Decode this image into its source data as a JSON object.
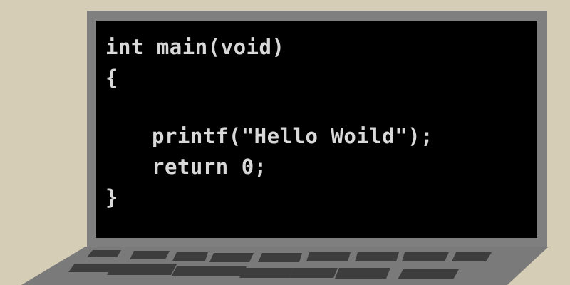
{
  "code": {
    "line1": "int main(void)",
    "line2": "{",
    "line3": "printf(\"Hello Woild\");",
    "line4": "return 0;",
    "line5": "}"
  },
  "colors": {
    "background": "#d5cdb6",
    "bezel": "#7f7f7f",
    "screen": "#000000",
    "code_text": "#d9d9d9",
    "keyboard_deck": "#7a7a7a",
    "keys": "#3d3d3d"
  }
}
